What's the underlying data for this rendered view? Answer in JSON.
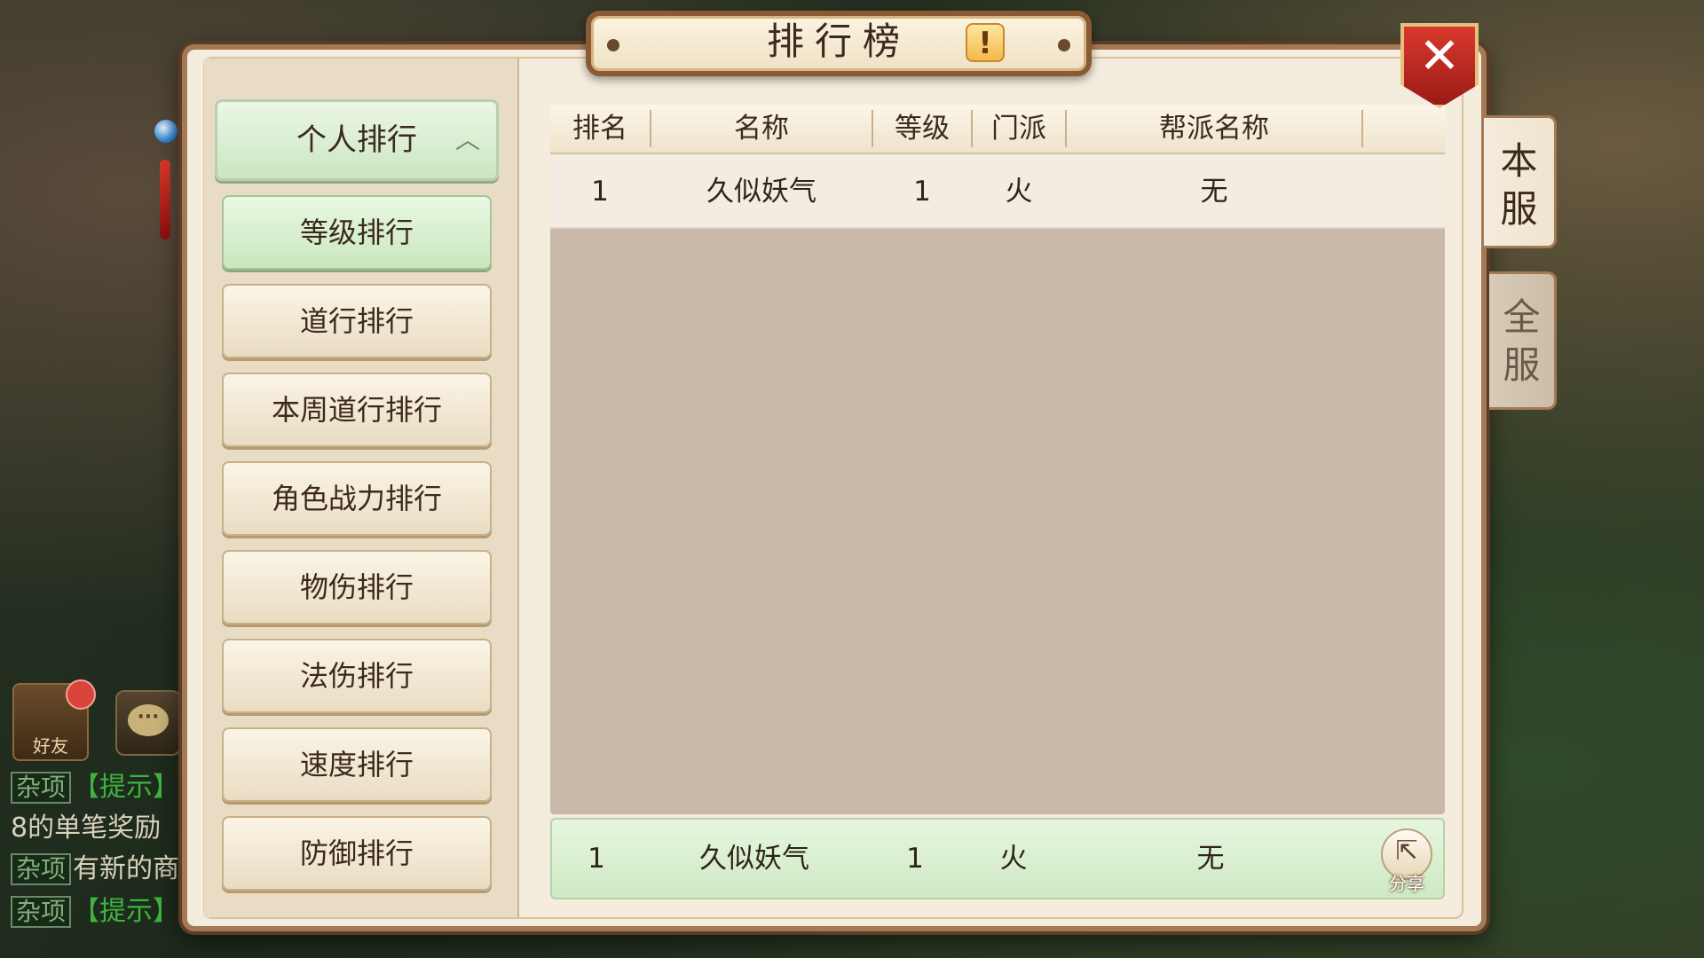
{
  "window": {
    "title": "排行榜",
    "info_icon": "!",
    "close_icon": "✕"
  },
  "sidebar": {
    "header": {
      "label": "个人排行",
      "icon": "chevron-up"
    },
    "items": [
      {
        "label": "等级排行",
        "selected": true
      },
      {
        "label": "道行排行",
        "selected": false
      },
      {
        "label": "本周道行排行",
        "selected": false
      },
      {
        "label": "角色战力排行",
        "selected": false
      },
      {
        "label": "物伤排行",
        "selected": false
      },
      {
        "label": "法伤排行",
        "selected": false
      },
      {
        "label": "速度排行",
        "selected": false
      },
      {
        "label": "防御排行",
        "selected": false
      }
    ]
  },
  "table": {
    "columns": [
      "排名",
      "名称",
      "等级",
      "门派",
      "帮派名称"
    ],
    "rows": [
      {
        "rank": "1",
        "name": "久似妖气",
        "level": "1",
        "faction": "火",
        "guild": "无"
      }
    ]
  },
  "self_row": {
    "rank": "1",
    "name": "久似妖气",
    "level": "1",
    "faction": "火",
    "guild": "无",
    "share_label": "分享"
  },
  "server_tabs": [
    {
      "label": "本服",
      "selected": true
    },
    {
      "label": "全服",
      "selected": false
    }
  ],
  "hud": {
    "friend_label": "好友",
    "chat_lines": [
      {
        "tag": "杂项",
        "text": "【提示】"
      },
      {
        "tag": "",
        "text": "8的单笔奖励"
      },
      {
        "tag": "杂项",
        "text": "有新的商"
      },
      {
        "tag": "杂项",
        "text": "【提示】"
      }
    ]
  },
  "colors": {
    "panel_bg": "#f4ecdc",
    "panel_border": "#a37a55",
    "selected_green": "#cfe9c4",
    "close_red": "#c92a22"
  }
}
